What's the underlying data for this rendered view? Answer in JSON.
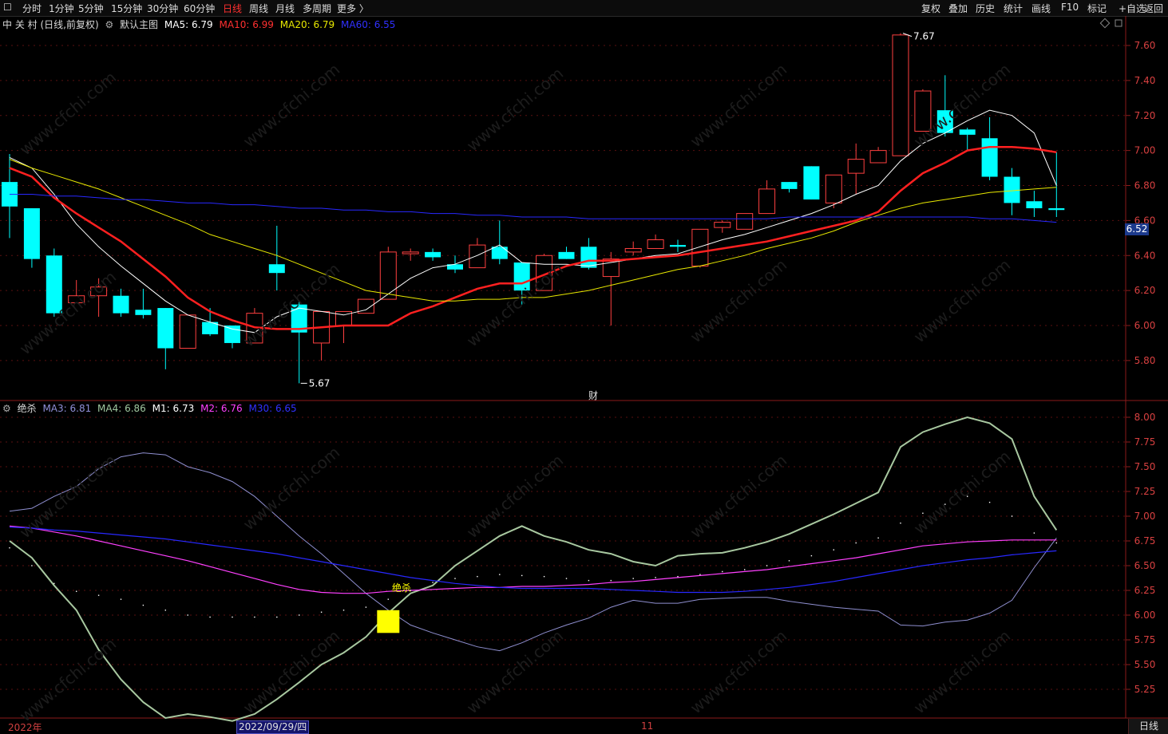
{
  "toolbar": {
    "left_items": [
      "分时",
      "1分钟",
      "5分钟",
      "15分钟",
      "30分钟",
      "60分钟",
      "日线",
      "周线",
      "月线",
      "多周期",
      "更多 〉"
    ],
    "active_item": "日线",
    "right_items": [
      "复权",
      "叠加",
      "历史",
      "统计",
      "画线",
      "F10",
      "标记",
      "+自选",
      "返回"
    ]
  },
  "main_legend": {
    "stock": "中 关 村 (日线,前复权)",
    "indicator": "默认主图",
    "ma5": "MA5: 6.79",
    "ma10": "MA10: 6.99",
    "ma20": "MA20: 6.79",
    "ma60": "MA60: 6.55",
    "colors": {
      "ma5": "#ffffff",
      "ma10": "#ff3030",
      "ma20": "#e8e800",
      "ma60": "#3030ff"
    }
  },
  "sub_legend": {
    "indicator": "绝杀",
    "ma3": "MA3: 6.81",
    "ma4": "MA4: 6.86",
    "m1": "M1: 6.73",
    "m2": "M2: 6.76",
    "m30": "M30: 6.65",
    "colors": {
      "ma3": "#9090d8",
      "ma4": "#a0c8a0",
      "m1": "#ffffff",
      "m2": "#ff40ff",
      "m30": "#3030ff"
    }
  },
  "annotations": {
    "high": "7.67",
    "low": "5.67",
    "fin_marker": "财",
    "signal": "绝杀"
  },
  "current_price": "6.52",
  "footer": {
    "year": "2022年",
    "date": "2022/09/29/四",
    "month": "11",
    "period": "日线"
  },
  "watermark": "www.cfchi.com",
  "chart_data": [
    {
      "type": "candlestick",
      "title": "中 关 村 (日线,前复权)",
      "ylim": [
        5.6,
        7.7
      ],
      "yticks": [
        5.8,
        6.0,
        6.2,
        6.4,
        6.6,
        6.8,
        7.0,
        7.2,
        7.4,
        7.6
      ],
      "up_color": "#ff4040",
      "down_color": "#00ffff",
      "candles": [
        [
          6.82,
          6.68,
          6.98,
          6.5
        ],
        [
          6.67,
          6.38,
          6.67,
          6.33
        ],
        [
          6.4,
          6.07,
          6.44,
          6.05
        ],
        [
          6.13,
          6.17,
          6.26,
          6.13
        ],
        [
          6.17,
          6.22,
          6.27,
          6.05
        ],
        [
          6.17,
          6.07,
          6.21,
          6.05
        ],
        [
          6.09,
          6.06,
          6.21,
          6.04
        ],
        [
          6.1,
          5.87,
          6.1,
          5.75
        ],
        [
          5.87,
          6.06,
          6.06,
          5.87
        ],
        [
          6.02,
          5.95,
          6.1,
          5.94
        ],
        [
          6.0,
          5.9,
          6.0,
          5.87
        ],
        [
          5.9,
          6.07,
          6.1,
          5.9
        ],
        [
          6.35,
          6.3,
          6.57,
          6.2
        ],
        [
          6.12,
          5.96,
          6.14,
          5.67
        ],
        [
          5.9,
          6.08,
          6.08,
          5.8
        ],
        [
          6.0,
          6.08,
          6.08,
          5.9
        ],
        [
          6.07,
          6.15,
          6.15,
          6.07
        ],
        [
          6.15,
          6.42,
          6.45,
          6.15
        ],
        [
          6.41,
          6.42,
          6.44,
          6.37
        ],
        [
          6.42,
          6.39,
          6.44,
          6.37
        ],
        [
          6.35,
          6.32,
          6.4,
          6.3
        ],
        [
          6.33,
          6.46,
          6.5,
          6.33
        ],
        [
          6.45,
          6.38,
          6.6,
          6.35
        ],
        [
          6.36,
          6.2,
          6.36,
          6.12
        ],
        [
          6.2,
          6.4,
          6.41,
          6.2
        ],
        [
          6.42,
          6.38,
          6.45,
          6.38
        ],
        [
          6.45,
          6.33,
          6.5,
          6.32
        ],
        [
          6.28,
          6.38,
          6.42,
          6.0
        ],
        [
          6.42,
          6.44,
          6.48,
          6.4
        ],
        [
          6.44,
          6.49,
          6.52,
          6.44
        ],
        [
          6.46,
          6.45,
          6.49,
          6.42
        ],
        [
          6.34,
          6.55,
          6.55,
          6.33
        ],
        [
          6.56,
          6.59,
          6.6,
          6.53
        ],
        [
          6.55,
          6.64,
          6.64,
          6.55
        ],
        [
          6.64,
          6.78,
          6.83,
          6.64
        ],
        [
          6.82,
          6.78,
          6.82,
          6.76
        ],
        [
          6.91,
          6.72,
          6.91,
          6.72
        ],
        [
          6.7,
          6.86,
          6.86,
          6.67
        ],
        [
          6.87,
          6.95,
          7.04,
          6.75
        ],
        [
          6.93,
          7.0,
          7.02,
          6.93
        ],
        [
          6.97,
          7.66,
          7.67,
          6.97
        ],
        [
          7.11,
          7.34,
          7.35,
          7.11
        ],
        [
          7.23,
          7.1,
          7.43,
          7.08
        ],
        [
          7.12,
          7.09,
          7.13,
          7.0
        ],
        [
          7.07,
          6.85,
          7.19,
          6.83
        ],
        [
          6.85,
          6.7,
          6.9,
          6.63
        ],
        [
          6.71,
          6.67,
          6.77,
          6.62
        ],
        [
          6.67,
          6.66,
          6.99,
          6.62
        ]
      ],
      "series": [
        {
          "name": "MA5",
          "values": [
            6.96,
            6.9,
            6.75,
            6.58,
            6.45,
            6.34,
            6.24,
            6.14,
            6.06,
            6.02,
            5.98,
            5.96,
            6.05,
            6.1,
            6.08,
            6.06,
            6.09,
            6.18,
            6.27,
            6.33,
            6.35,
            6.4,
            6.46,
            6.36,
            6.35,
            6.35,
            6.34,
            6.36,
            6.38,
            6.4,
            6.41,
            6.45,
            6.49,
            6.52,
            6.56,
            6.6,
            6.64,
            6.69,
            6.75,
            6.8,
            6.94,
            7.04,
            7.1,
            7.17,
            7.23,
            7.2,
            7.1,
            6.8
          ]
        },
        {
          "name": "MA10",
          "values": [
            6.9,
            6.85,
            6.73,
            6.64,
            6.56,
            6.48,
            6.38,
            6.28,
            6.16,
            6.08,
            6.03,
            5.99,
            5.98,
            5.98,
            5.99,
            6.0,
            6.0,
            6.0,
            6.07,
            6.11,
            6.16,
            6.21,
            6.24,
            6.24,
            6.29,
            6.34,
            6.37,
            6.37,
            6.38,
            6.39,
            6.4,
            6.42,
            6.44,
            6.46,
            6.48,
            6.51,
            6.54,
            6.57,
            6.6,
            6.65,
            6.77,
            6.87,
            6.93,
            7.0,
            7.02,
            7.02,
            7.01,
            6.99
          ]
        },
        {
          "name": "MA20",
          "values": [
            6.95,
            6.9,
            6.86,
            6.82,
            6.78,
            6.73,
            6.68,
            6.63,
            6.58,
            6.52,
            6.48,
            6.44,
            6.4,
            6.35,
            6.3,
            6.25,
            6.2,
            6.18,
            6.16,
            6.14,
            6.14,
            6.15,
            6.15,
            6.16,
            6.16,
            6.18,
            6.2,
            6.23,
            6.26,
            6.29,
            6.32,
            6.34,
            6.37,
            6.4,
            6.44,
            6.47,
            6.5,
            6.54,
            6.59,
            6.63,
            6.67,
            6.7,
            6.72,
            6.74,
            6.76,
            6.77,
            6.78,
            6.79
          ]
        },
        {
          "name": "MA60",
          "values": [
            6.75,
            6.75,
            6.74,
            6.74,
            6.73,
            6.72,
            6.72,
            6.71,
            6.7,
            6.7,
            6.69,
            6.69,
            6.68,
            6.67,
            6.67,
            6.66,
            6.66,
            6.65,
            6.65,
            6.64,
            6.64,
            6.63,
            6.63,
            6.62,
            6.62,
            6.62,
            6.61,
            6.61,
            6.61,
            6.61,
            6.61,
            6.61,
            6.61,
            6.61,
            6.61,
            6.62,
            6.62,
            6.62,
            6.62,
            6.62,
            6.62,
            6.62,
            6.62,
            6.62,
            6.61,
            6.61,
            6.6,
            6.59
          ]
        }
      ]
    },
    {
      "type": "line",
      "title": "绝杀",
      "ylim": [
        5.0,
        8.1
      ],
      "yticks": [
        5.25,
        5.5,
        5.75,
        6.0,
        6.25,
        6.5,
        6.75,
        7.0,
        7.25,
        7.5,
        7.75,
        8.0
      ],
      "series": [
        {
          "name": "MA3",
          "values": [
            7.05,
            7.08,
            7.2,
            7.3,
            7.48,
            7.6,
            7.64,
            7.62,
            7.5,
            7.44,
            7.35,
            7.2,
            7.0,
            6.8,
            6.62,
            6.42,
            6.22,
            6.05,
            5.9,
            5.82,
            5.75,
            5.68,
            5.64,
            5.72,
            5.82,
            5.9,
            5.97,
            6.08,
            6.15,
            6.12,
            6.12,
            6.16,
            6.17,
            6.18,
            6.18,
            6.14,
            6.11,
            6.08,
            6.06,
            6.04,
            5.9,
            5.89,
            5.93,
            5.95,
            6.02,
            6.15,
            6.48,
            6.78
          ]
        },
        {
          "name": "MA4",
          "values": [
            6.75,
            6.58,
            6.3,
            6.05,
            5.65,
            5.35,
            5.12,
            4.96,
            5.0,
            4.97,
            4.93,
            5.0,
            5.15,
            5.32,
            5.5,
            5.62,
            5.78,
            6.02,
            6.22,
            6.3,
            6.5,
            6.65,
            6.8,
            6.9,
            6.8,
            6.74,
            6.66,
            6.62,
            6.54,
            6.5,
            6.6,
            6.62,
            6.63,
            6.68,
            6.74,
            6.82,
            6.92,
            7.02,
            7.13,
            7.24,
            7.7,
            7.85,
            7.93,
            8.0,
            7.94,
            7.78,
            7.2,
            6.86
          ]
        },
        {
          "name": "M2",
          "values": [
            6.9,
            6.88,
            6.84,
            6.8,
            6.75,
            6.7,
            6.65,
            6.6,
            6.55,
            6.49,
            6.43,
            6.37,
            6.31,
            6.26,
            6.23,
            6.22,
            6.22,
            6.24,
            6.25,
            6.26,
            6.27,
            6.28,
            6.28,
            6.29,
            6.29,
            6.3,
            6.31,
            6.33,
            6.34,
            6.36,
            6.38,
            6.4,
            6.42,
            6.44,
            6.46,
            6.49,
            6.52,
            6.55,
            6.58,
            6.62,
            6.66,
            6.7,
            6.72,
            6.74,
            6.75,
            6.76,
            6.76,
            6.76
          ]
        },
        {
          "name": "M30",
          "values": [
            6.89,
            6.88,
            6.86,
            6.85,
            6.83,
            6.81,
            6.79,
            6.77,
            6.74,
            6.71,
            6.68,
            6.65,
            6.62,
            6.58,
            6.54,
            6.5,
            6.46,
            6.42,
            6.38,
            6.35,
            6.32,
            6.3,
            6.28,
            6.27,
            6.27,
            6.27,
            6.27,
            6.26,
            6.25,
            6.24,
            6.23,
            6.23,
            6.23,
            6.24,
            6.26,
            6.28,
            6.31,
            6.34,
            6.38,
            6.42,
            6.46,
            6.5,
            6.53,
            6.56,
            6.58,
            6.61,
            6.63,
            6.65
          ]
        }
      ],
      "m1_dots": [
        6.68,
        6.5,
        6.32,
        6.24,
        6.2,
        6.16,
        6.1,
        6.05,
        6.0,
        5.98,
        5.98,
        5.98,
        5.98,
        6.0,
        6.03,
        6.05,
        6.08,
        6.16,
        6.25,
        6.33,
        6.37,
        6.39,
        6.41,
        6.4,
        6.39,
        6.37,
        6.35,
        6.35,
        6.37,
        6.38,
        6.39,
        6.41,
        6.44,
        6.46,
        6.5,
        6.55,
        6.6,
        6.66,
        6.73,
        6.78,
        6.93,
        7.03,
        7.12,
        7.2,
        7.14,
        7.0,
        6.83,
        6.73
      ],
      "signal_bar": {
        "index": 17,
        "top": 6.05,
        "bottom": 5.82,
        "color": "#ffff00"
      }
    }
  ]
}
